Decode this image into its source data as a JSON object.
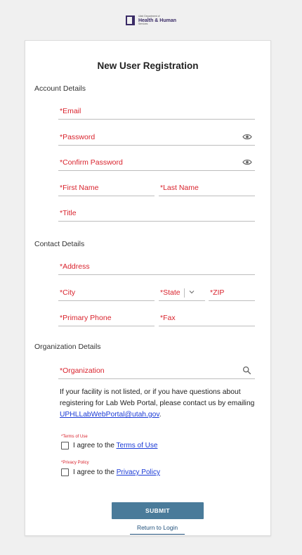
{
  "logo": {
    "line1": "Utah Department of",
    "line2": "Health & Human",
    "line3": "Services"
  },
  "form": {
    "title": "New User Registration",
    "sections": {
      "account": "Account Details",
      "contact": "Contact Details",
      "organization": "Organization Details"
    },
    "fields": {
      "email": "*Email",
      "password": "*Password",
      "confirm_password": "*Confirm Password",
      "first_name": "*First Name",
      "last_name": "*Last Name",
      "title": "*Title",
      "address": "*Address",
      "city": "*City",
      "state": "*State",
      "zip": "*ZIP",
      "primary_phone": "*Primary Phone",
      "fax": "*Fax",
      "organization": "*Organization"
    },
    "info": {
      "text": "If your facility is not listed, or if you have questions about registering for Lab Web Portal, please contact us by emailing ",
      "email": "UPHLLabWebPortal@utah.gov",
      "suffix": "."
    },
    "terms": {
      "required_label": "*Terms of Use",
      "prefix": "I agree to the ",
      "link": "Terms of Use",
      "checked": false
    },
    "privacy": {
      "required_label": "*Privacy Policy",
      "prefix": "I agree to the ",
      "link": "Privacy Policy",
      "checked": false
    },
    "submit_label": "SUBMIT",
    "return_label": "Return to Login"
  },
  "icons": {
    "password_toggle": "eye-icon",
    "organization_search": "search-icon",
    "state_dropdown": "chevron-down-icon"
  },
  "colors": {
    "required": "#d9232d",
    "link": "#1a3ad6",
    "button": "#4a7b9a",
    "brand": "#3a2b66"
  }
}
